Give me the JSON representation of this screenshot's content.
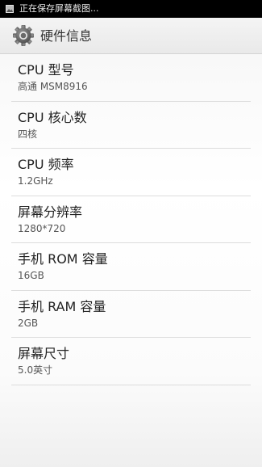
{
  "status_bar": {
    "notification_icon": "image-icon",
    "text": "正在保存屏幕截图..."
  },
  "action_bar": {
    "icon": "gear-icon",
    "title": "硬件信息"
  },
  "items": [
    {
      "title": "CPU 型号",
      "value": "高通 MSM8916"
    },
    {
      "title": "CPU 核心数",
      "value": "四核"
    },
    {
      "title": "CPU 频率",
      "value": "1.2GHz"
    },
    {
      "title": "屏幕分辨率",
      "value": "1280*720"
    },
    {
      "title": "手机 ROM 容量",
      "value": "16GB"
    },
    {
      "title": "手机 RAM 容量",
      "value": "2GB"
    },
    {
      "title": "屏幕尺寸",
      "value": "5.0英寸"
    }
  ]
}
